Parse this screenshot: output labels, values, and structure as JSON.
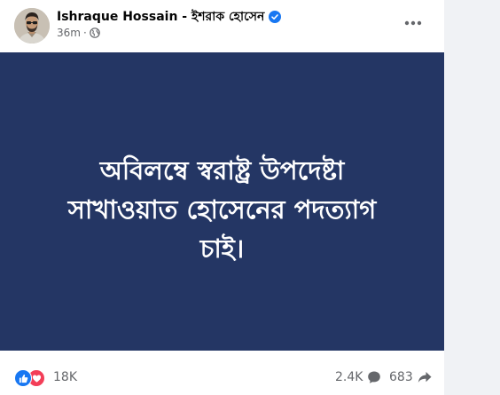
{
  "author": {
    "name": "Ishraque Hossain - ইশরাক হোসেন"
  },
  "meta": {
    "time": "36m",
    "separator": "·",
    "audience_icon": "globe-icon"
  },
  "post": {
    "lines": [
      "অবিলম্বে স্বরাষ্ট্র উপদেষ্টা",
      "সাখাওয়াত হোসেনের পদত্যাগ",
      "চাই।"
    ],
    "background_color": "#243664",
    "text_color": "#ffffff"
  },
  "reactions": {
    "icons": [
      "like-icon",
      "love-icon"
    ],
    "count": "18K"
  },
  "stats": {
    "comments": "2.4K",
    "shares": "683"
  },
  "colors": {
    "accent": "#1877f2",
    "love": "#f33e58",
    "secondary_text": "#65676b"
  }
}
